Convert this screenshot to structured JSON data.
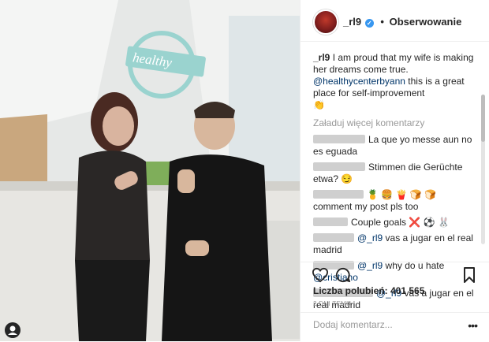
{
  "post": {
    "username": "_rl9",
    "separator": "•",
    "follow_status": "Obserwowanie",
    "caption_user": "_rl9",
    "caption_text": " I am proud that my wife is making her dreams come true. ",
    "caption_mention": "@healthycenterbyann",
    "caption_text_2": " this is a great place for self-improvement",
    "caption_emoji": "👏",
    "load_more": "Załaduj więcej komentarzy",
    "comments": [
      {
        "text": "La que yo messe aun no es eguada"
      },
      {
        "text": "Stimmen die Gerüchte etwa?",
        "emoji": "😏"
      },
      {
        "emoji_row": "🍍 🍔 🍟 🍞 🍞",
        "text": "comment my post pls too"
      },
      {
        "text": "Couple goals",
        "emoji": "❌ ⚽ 🐰"
      },
      {
        "mention": "@_rl9",
        "text": " vas a jugar en el real madrid"
      },
      {
        "mention": "@_rl9",
        "text": " why do u hate ",
        "mention2": "@cristiano"
      },
      {
        "mention": "@_rl9",
        "text": " vas a jugar en el real madrid"
      }
    ],
    "likes_label": "Liczba polubień: 401 565",
    "date": "2 DNI TEMU",
    "add_comment_placeholder": "Dodaj komentarz...",
    "more_options": "•••"
  },
  "photo": {
    "sign_text": "healthy"
  },
  "icons": {
    "verified": "verified-badge-icon",
    "like": "heart-icon",
    "comment": "comment-icon",
    "save": "bookmark-icon",
    "tagged": "tagged-user-icon"
  },
  "colors": {
    "accent": "#3897f0",
    "mention": "#003569",
    "muted": "#999999"
  }
}
